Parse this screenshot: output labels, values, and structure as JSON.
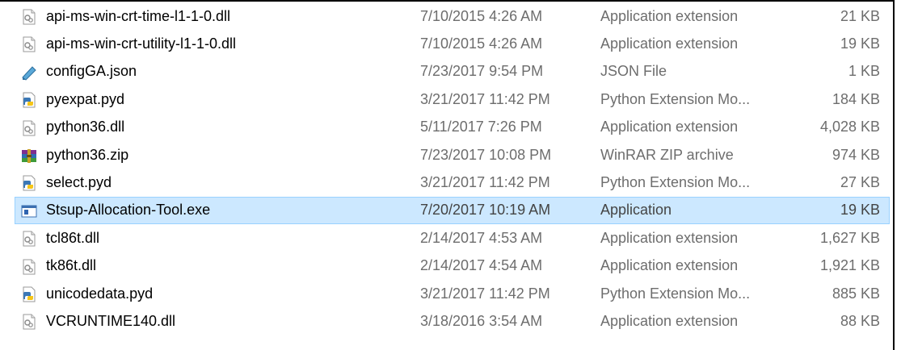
{
  "files": [
    {
      "name": "api-ms-win-crt-time-l1-1-0.dll",
      "date": "7/10/2015 4:26 AM",
      "type": "Application extension",
      "size": "21 KB",
      "icon": "dll-icon"
    },
    {
      "name": "api-ms-win-crt-utility-l1-1-0.dll",
      "date": "7/10/2015 4:26 AM",
      "type": "Application extension",
      "size": "19 KB",
      "icon": "dll-icon"
    },
    {
      "name": "configGA.json",
      "date": "7/23/2017 9:54 PM",
      "type": "JSON File",
      "size": "1 KB",
      "icon": "json-file-icon"
    },
    {
      "name": "pyexpat.pyd",
      "date": "3/21/2017 11:42 PM",
      "type": "Python Extension Mo...",
      "size": "184 KB",
      "icon": "python-file-icon"
    },
    {
      "name": "python36.dll",
      "date": "5/11/2017 7:26 PM",
      "type": "Application extension",
      "size": "4,028 KB",
      "icon": "dll-icon"
    },
    {
      "name": "python36.zip",
      "date": "7/23/2017 10:08 PM",
      "type": "WinRAR ZIP archive",
      "size": "974 KB",
      "icon": "winrar-archive-icon"
    },
    {
      "name": "select.pyd",
      "date": "3/21/2017 11:42 PM",
      "type": "Python Extension Mo...",
      "size": "27 KB",
      "icon": "python-file-icon"
    },
    {
      "name": "Stsup-Allocation-Tool.exe",
      "date": "7/20/2017 10:19 AM",
      "type": "Application",
      "size": "19 KB",
      "icon": "exe-application-icon",
      "selected": true
    },
    {
      "name": "tcl86t.dll",
      "date": "2/14/2017 4:53 AM",
      "type": "Application extension",
      "size": "1,627 KB",
      "icon": "dll-icon"
    },
    {
      "name": "tk86t.dll",
      "date": "2/14/2017 4:54 AM",
      "type": "Application extension",
      "size": "1,921 KB",
      "icon": "dll-icon"
    },
    {
      "name": "unicodedata.pyd",
      "date": "3/21/2017 11:42 PM",
      "type": "Python Extension Mo...",
      "size": "885 KB",
      "icon": "python-file-icon"
    },
    {
      "name": "VCRUNTIME140.dll",
      "date": "3/18/2016 3:54 AM",
      "type": "Application extension",
      "size": "88 KB",
      "icon": "dll-icon"
    }
  ],
  "colors": {
    "selection_bg": "#cce8ff",
    "selection_border": "#99d1ff",
    "secondary_text": "#6d6d6d"
  }
}
